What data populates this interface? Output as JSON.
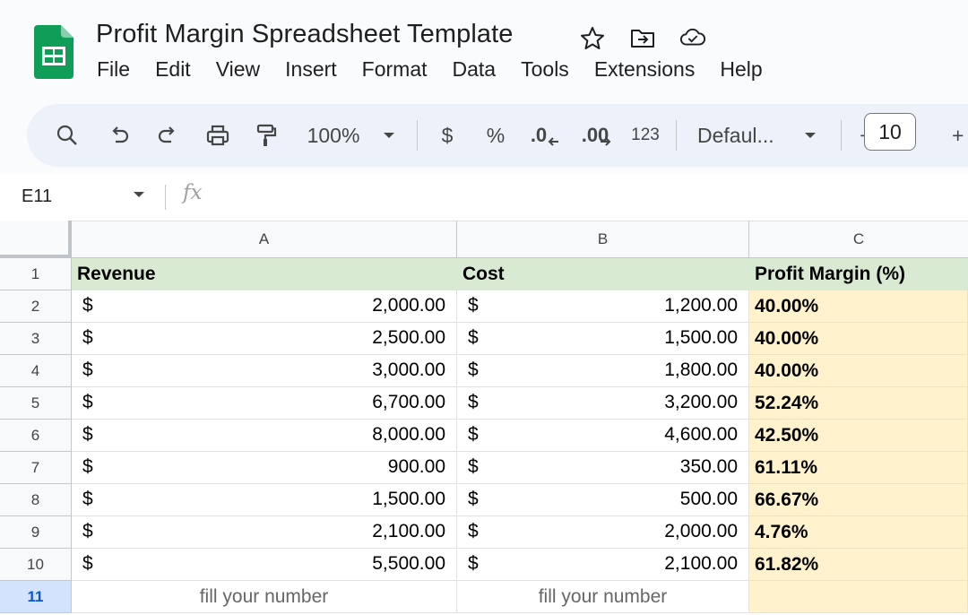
{
  "document": {
    "title": "Profit Margin Spreadsheet Template"
  },
  "menu": [
    "File",
    "Edit",
    "View",
    "Insert",
    "Format",
    "Data",
    "Tools",
    "Extensions",
    "Help"
  ],
  "toolbar": {
    "zoom": "100%",
    "currency": "$",
    "percent": "%",
    "decrease_decimal": ".0",
    "increase_decimal": ".00",
    "number_format": "123",
    "font": "Defaul...",
    "minus": "−",
    "font_size": "10",
    "plus": "+"
  },
  "formula_bar": {
    "name_box": "E11",
    "fx": "fx",
    "value": ""
  },
  "columns": [
    "A",
    "B",
    "C"
  ],
  "rows": [
    "1",
    "2",
    "3",
    "4",
    "5",
    "6",
    "7",
    "8",
    "9",
    "10",
    "11"
  ],
  "selected_row": "11",
  "headers": {
    "a": "Revenue",
    "b": "Cost",
    "c": "Profit Margin (%)"
  },
  "currency_symbol": "$",
  "data_rows": [
    {
      "revenue": "2,000.00",
      "cost": "1,200.00",
      "margin": "40.00%"
    },
    {
      "revenue": "2,500.00",
      "cost": "1,500.00",
      "margin": "40.00%"
    },
    {
      "revenue": "3,000.00",
      "cost": "1,800.00",
      "margin": "40.00%"
    },
    {
      "revenue": "6,700.00",
      "cost": "3,200.00",
      "margin": "52.24%"
    },
    {
      "revenue": "8,000.00",
      "cost": "4,600.00",
      "margin": "42.50%"
    },
    {
      "revenue": "900.00",
      "cost": "350.00",
      "margin": "61.11%"
    },
    {
      "revenue": "1,500.00",
      "cost": "500.00",
      "margin": "66.67%"
    },
    {
      "revenue": "2,100.00",
      "cost": "2,000.00",
      "margin": "4.76%"
    },
    {
      "revenue": "5,500.00",
      "cost": "2,100.00",
      "margin": "61.82%"
    }
  ],
  "placeholder_row": {
    "a": "fill your number",
    "b": "fill your number",
    "c": ""
  },
  "colors": {
    "header_fill": "#d9ead3",
    "margin_fill": "#fff2cc",
    "sheets_green": "#0f9d58",
    "selection_blue": "#d3e3fd"
  }
}
